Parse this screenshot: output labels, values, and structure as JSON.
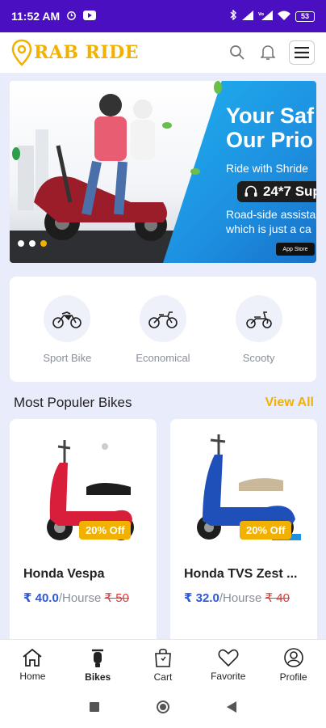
{
  "status_bar": {
    "time": "11:52 AM",
    "battery": "53"
  },
  "app": {
    "name": "RAB RIDE",
    "brand_color": "#f2b100",
    "accent_color": "#4a0fc0"
  },
  "header": {
    "icons": [
      "search-icon",
      "bell-icon",
      "menu-icon"
    ]
  },
  "banner": {
    "title_line1": "Your Saf",
    "title_line2": "Our Prio",
    "subtitle": "Ride with Shride",
    "pill": "24*7 Sup",
    "desc_line1": "Road-side assista",
    "desc_line2": "which is just a ca",
    "store_badge": "App Store",
    "active_slide": 3,
    "slides": 3
  },
  "categories": [
    {
      "label": "Sport Bike",
      "icon": "sport-bike-icon"
    },
    {
      "label": "Economical",
      "icon": "economical-bike-icon"
    },
    {
      "label": "Scooty",
      "icon": "scooty-icon"
    }
  ],
  "popular": {
    "title": "Most Populer Bikes",
    "view_all": "View All",
    "items": [
      {
        "name": "Honda Vespa",
        "price": "₹ 40.0",
        "per": "/Hourse",
        "old_price": "₹ 50",
        "badge": "20% Off",
        "color": "#d81e3a"
      },
      {
        "name": "Honda TVS Zest ...",
        "price": "₹ 32.0",
        "per": "/Hourse",
        "old_price": "₹ 40",
        "badge": "20% Off",
        "color": "#1f4fb8"
      }
    ]
  },
  "bottom_nav": [
    {
      "label": "Home",
      "icon": "home-icon"
    },
    {
      "label": "Bikes",
      "icon": "bike-icon",
      "active": true
    },
    {
      "label": "Cart",
      "icon": "cart-icon"
    },
    {
      "label": "Favorite",
      "icon": "heart-icon"
    },
    {
      "label": "Profile",
      "icon": "profile-icon"
    }
  ]
}
